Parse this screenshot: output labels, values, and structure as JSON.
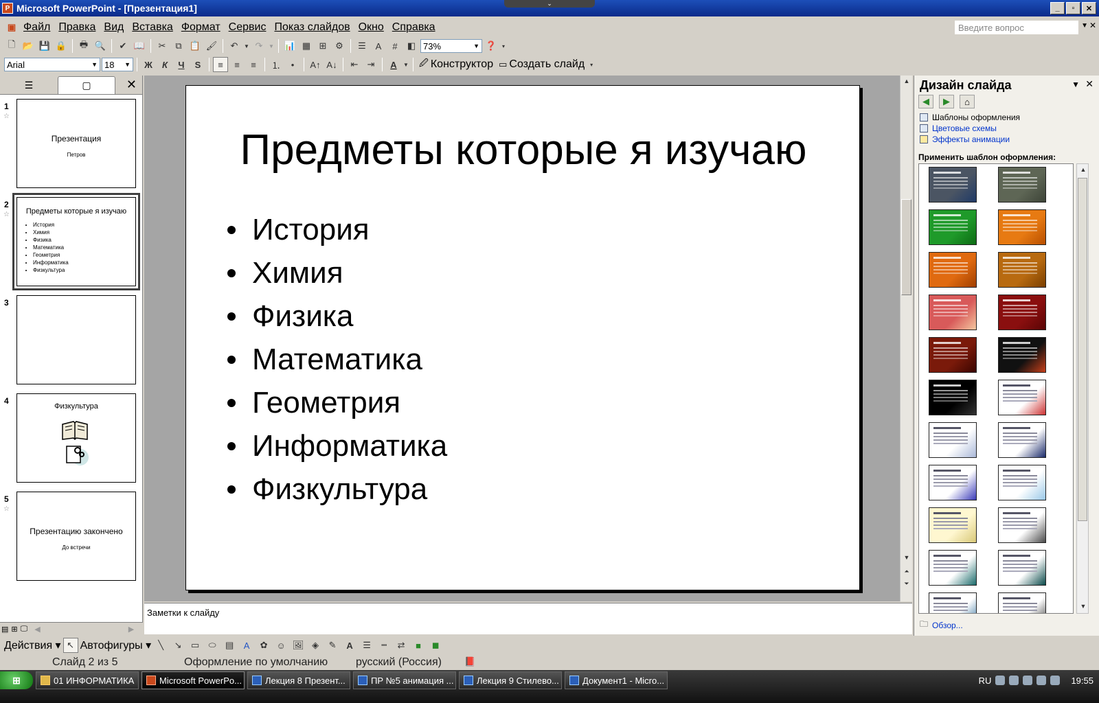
{
  "window": {
    "title": "Microsoft PowerPoint - [Презентация1]",
    "app_letter": "P",
    "min": "_",
    "max": "▫",
    "close": "✕",
    "top_tab": "⌄"
  },
  "menu": {
    "items": [
      "Файл",
      "Правка",
      "Вид",
      "Вставка",
      "Формат",
      "Сервис",
      "Показ слайдов",
      "Окно",
      "Справка"
    ],
    "ask_placeholder": "Введите вопрос"
  },
  "toolbar_standard": {
    "zoom": "73%"
  },
  "toolbar_format": {
    "font": "Arial",
    "size": "18",
    "bold": "Ж",
    "italic": "К",
    "underline": "Ч",
    "shadow": "S",
    "designer": "Конструктор",
    "new_slide": "Создать слайд"
  },
  "slides_pane": {
    "slides": [
      {
        "num": "1",
        "title": "Презентация",
        "subtitle": "Петров"
      },
      {
        "num": "2",
        "title": "Предметы которые я изучаю",
        "items": [
          "История",
          "Химия",
          "Физика",
          "Математика",
          "Геометрия",
          "Информатика",
          "Физкультура"
        ]
      },
      {
        "num": "3"
      },
      {
        "num": "4",
        "title": "Физкультура"
      },
      {
        "num": "5",
        "title": "Презентацию закончено",
        "subtitle": "До встречи"
      }
    ]
  },
  "slide": {
    "title": "Предметы которые я изучаю",
    "bullets": [
      "История",
      "Химия",
      "Физика",
      "Математика",
      "Геометрия",
      "Информатика",
      "Физкультура"
    ]
  },
  "notes": {
    "placeholder": "Заметки к слайду"
  },
  "task_pane": {
    "title": "Дизайн слайда",
    "links": [
      "Шаблоны оформления",
      "Цветовые схемы",
      "Эффекты анимации"
    ],
    "apply_label": "Применить шаблон оформления:",
    "browse": "Обзор...",
    "templates": [
      {
        "bg": "#4b5563",
        "accent": "#1f3a68"
      },
      {
        "bg": "#5e6655",
        "accent": "#3d4438"
      },
      {
        "bg": "#1f9a2a",
        "accent": "#0d6b14"
      },
      {
        "bg": "#e77a12",
        "accent": "#b84f00"
      },
      {
        "bg": "#e06a10",
        "accent": "#a03f00"
      },
      {
        "bg": "#b86a10",
        "accent": "#7a3f00"
      },
      {
        "bg": "#d85a5a",
        "accent": "#f4c8a0"
      },
      {
        "bg": "#8a0f0f",
        "accent": "#5a0505"
      },
      {
        "bg": "#7a1a0a",
        "accent": "#3a0500"
      },
      {
        "bg": "#111111",
        "accent": "#c8401a"
      },
      {
        "bg": "#000000",
        "accent": "#333333"
      },
      {
        "bg": "#ffffff",
        "accent": "#cc3333"
      },
      {
        "bg": "#ffffff",
        "accent": "#aab8d8"
      },
      {
        "bg": "#ffffff",
        "accent": "#1a2a6a"
      },
      {
        "bg": "#ffffff",
        "accent": "#3a3ab8"
      },
      {
        "bg": "#ffffff",
        "accent": "#9ac8e8"
      },
      {
        "bg": "#fff7d0",
        "accent": "#d8c878"
      },
      {
        "bg": "#ffffff",
        "accent": "#4a4a4a"
      },
      {
        "bg": "#ffffff",
        "accent": "#1a6a6a"
      },
      {
        "bg": "#ffffff",
        "accent": "#0a4a4a"
      },
      {
        "bg": "#ffffff",
        "accent": "#2a6a9a"
      },
      {
        "bg": "#ffffff",
        "accent": "#333333"
      }
    ]
  },
  "drawing": {
    "actions": "Действия",
    "autoshapes": "Автофигуры"
  },
  "status": {
    "slide_of": "Слайд 2 из 5",
    "design": "Оформление по умолчанию",
    "language": "русский (Россия)"
  },
  "taskbar": {
    "tasks": [
      {
        "label": "01 ИНФОРМАТИКА",
        "kind": "folder"
      },
      {
        "label": "Microsoft PowerPo...",
        "kind": "pp"
      },
      {
        "label": "Лекция 8 Презент...",
        "kind": "word"
      },
      {
        "label": "ПР №5 анимация ...",
        "kind": "word"
      },
      {
        "label": "Лекция 9 Стилево...",
        "kind": "word"
      },
      {
        "label": "Документ1 - Micro...",
        "kind": "word"
      }
    ],
    "lang": "RU",
    "clock": "19:55"
  }
}
